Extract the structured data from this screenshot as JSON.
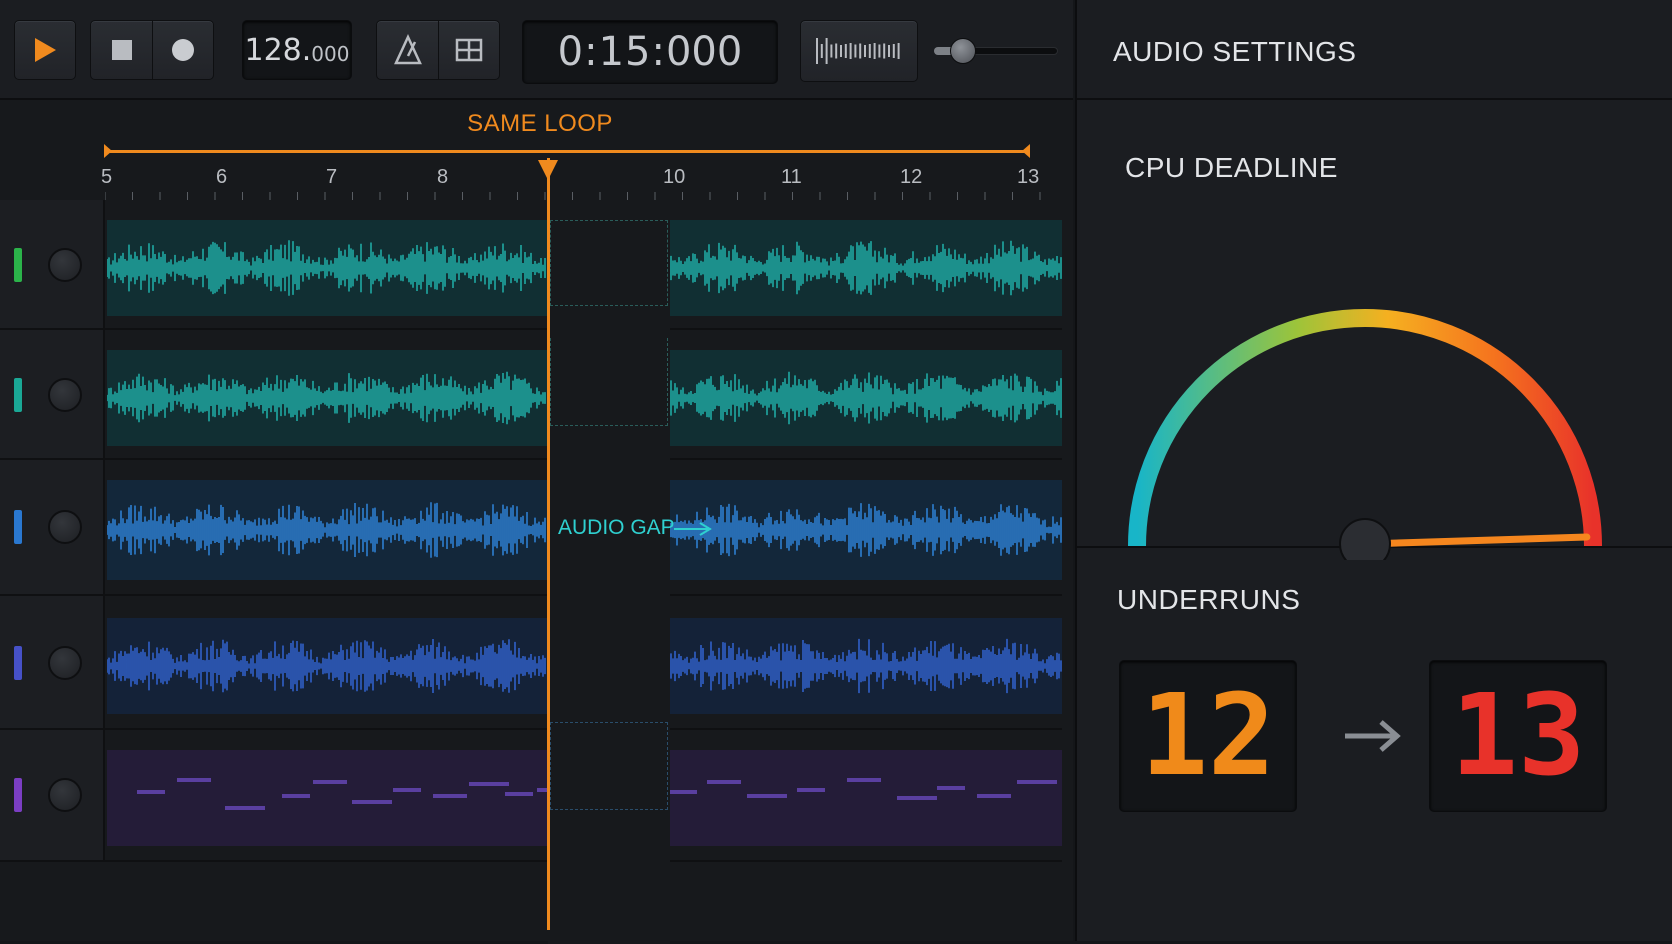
{
  "transport": {
    "play_icon": "play-icon",
    "stop_icon": "stop-icon",
    "record_icon": "record-icon",
    "tempo_int": "128.",
    "tempo_dec": "000",
    "metronome_icon": "metronome-icon",
    "loop_icon": "loop-icon",
    "time_main": "0:15:",
    "time_ms": "000",
    "waveform_icon": "waveform-icon",
    "master_volume_fraction": 0.2
  },
  "arrangement": {
    "loop_label": "SAME LOOP",
    "ruler_bars": [
      "5",
      "6",
      "7",
      "8",
      "10",
      "11",
      "12",
      "13"
    ],
    "gap_label": "AUDIO GAP",
    "tracks": [
      {
        "color": "#2bb34a",
        "type": "audio"
      },
      {
        "color": "#1aa896",
        "type": "audio"
      },
      {
        "color": "#2a78d0",
        "type": "audio"
      },
      {
        "color": "#4651c8",
        "type": "audio"
      },
      {
        "color": "#7b3ec3",
        "type": "midi"
      }
    ]
  },
  "settings": {
    "title": "AUDIO SETTINGS",
    "cpu_label": "CPU DEADLINE",
    "cpu_gauge_fraction": 0.99,
    "underruns_label": "UNDERRUNS",
    "underruns_before": "12",
    "underruns_after": "13",
    "colors": {
      "accent": "#f28a1e",
      "before": "#f08a1a",
      "after": "#e8322a",
      "gap": "#2fd0d0"
    }
  }
}
